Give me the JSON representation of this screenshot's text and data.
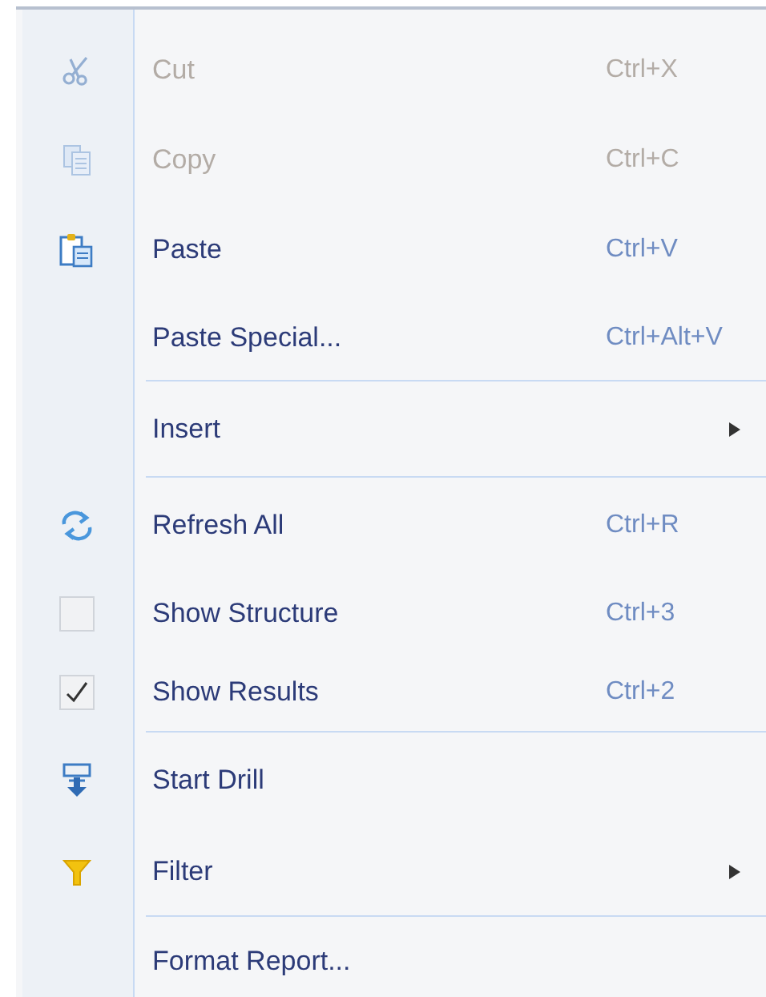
{
  "menu": {
    "items": [
      {
        "kind": "item",
        "label": "Cut",
        "shortcut": "Ctrl+X",
        "disabled": true,
        "submenu": false
      },
      {
        "kind": "item",
        "label": "Copy",
        "shortcut": "Ctrl+C",
        "disabled": true,
        "submenu": false
      },
      {
        "kind": "item",
        "label": "Paste",
        "shortcut": "Ctrl+V",
        "disabled": false,
        "submenu": false
      },
      {
        "kind": "item",
        "label": "Paste Special...",
        "shortcut": "Ctrl+Alt+V",
        "disabled": false,
        "submenu": false
      },
      {
        "kind": "separator"
      },
      {
        "kind": "item",
        "label": "Insert",
        "disabled": false,
        "submenu": true
      },
      {
        "kind": "separator"
      },
      {
        "kind": "item",
        "label": "Refresh All",
        "shortcut": "Ctrl+R",
        "disabled": false,
        "submenu": false
      },
      {
        "kind": "check",
        "label": "Show Structure",
        "shortcut": "Ctrl+3",
        "disabled": false,
        "checked": false,
        "submenu": false
      },
      {
        "kind": "check",
        "label": "Show Results",
        "shortcut": "Ctrl+2",
        "disabled": false,
        "checked": true,
        "submenu": false
      },
      {
        "kind": "separator"
      },
      {
        "kind": "item",
        "label": "Start Drill",
        "disabled": false,
        "submenu": false
      },
      {
        "kind": "item",
        "label": "Filter",
        "disabled": false,
        "submenu": true
      },
      {
        "kind": "separator"
      },
      {
        "kind": "item",
        "label": "Format Report...",
        "disabled": false,
        "submenu": false
      }
    ]
  }
}
